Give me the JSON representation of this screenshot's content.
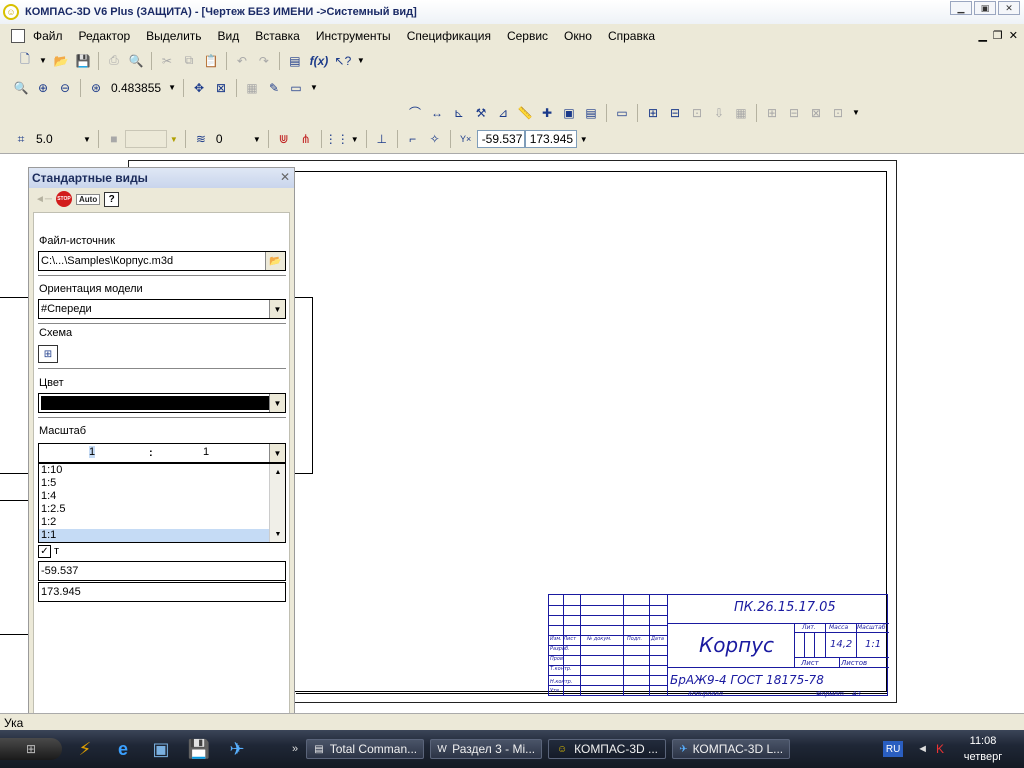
{
  "window": {
    "title": "КОМПАС-3D V6 Plus (ЗАЩИТА) - [Чертеж БЕЗ ИМЕНИ ->Системный вид]",
    "icon": "kompas-icon"
  },
  "menu": {
    "items": [
      "Файл",
      "Редактор",
      "Выделить",
      "Вид",
      "Вставка",
      "Инструменты",
      "Спецификация",
      "Сервис",
      "Окно",
      "Справка"
    ]
  },
  "toolbar_view": {
    "zoom_value": "0.483855"
  },
  "toolbar_current": {
    "step_value": "5.0",
    "layer_value": "0",
    "x_coord": "-59.537",
    "y_coord": "173.945"
  },
  "panel": {
    "title": "Стандартные виды",
    "auto_label": "Auto",
    "stop_label": "STOP",
    "source_label": "Файл-источник",
    "source_value": "C:\\...\\Samples\\Корпус.m3d",
    "orientation_label": "Ориентация модели",
    "orientation_value": "#Спереди",
    "schema_label": "Схема",
    "color_label": "Цвет",
    "color_value": "#000000",
    "scale_label": "Масштаб",
    "scale_left": "1",
    "scale_sep": ":",
    "scale_right": "1",
    "scale_options": [
      "1:10",
      "1:5",
      "1:4",
      "1:2.5",
      "1:2",
      "1:1"
    ],
    "scale_selected": "1:1",
    "checkbox_label": "т",
    "x_value": "-59.537",
    "y_value": "173.945"
  },
  "drawing": {
    "designation": "ПК.26.15.17.05",
    "name": "Корпус",
    "material": "БрАЖ9-4  ГОСТ 18175-78",
    "mass": "14,2",
    "scale": "1:1",
    "headers": {
      "lit": "Лит.",
      "massa": "Масса",
      "masshtab": "Масштаб",
      "list": "Лист",
      "listov": "Листов"
    },
    "rows_left": [
      "Изм. Лист",
      "№ докум.",
      "Подп.",
      "Дата",
      "Разраб.",
      "Пров.",
      "Т.контр.",
      "Н.контр.",
      "Утв."
    ],
    "footer_copied": "Копировал",
    "footer_format": "Формат",
    "footer_format_value": "A3"
  },
  "status": {
    "text": "Ука"
  },
  "taskbar": {
    "tasks": [
      {
        "label": "Total Comman...",
        "icon": "disk-icon"
      },
      {
        "label": "Раздел 3 - Mi...",
        "icon": "word-icon"
      },
      {
        "label": "КОМПАС-3D ...",
        "icon": "kompas-icon"
      },
      {
        "label": "КОМПАС-3D L...",
        "icon": "kompas-lt-icon"
      }
    ],
    "lang": "RU",
    "time": "11:08",
    "day": "четверг"
  }
}
